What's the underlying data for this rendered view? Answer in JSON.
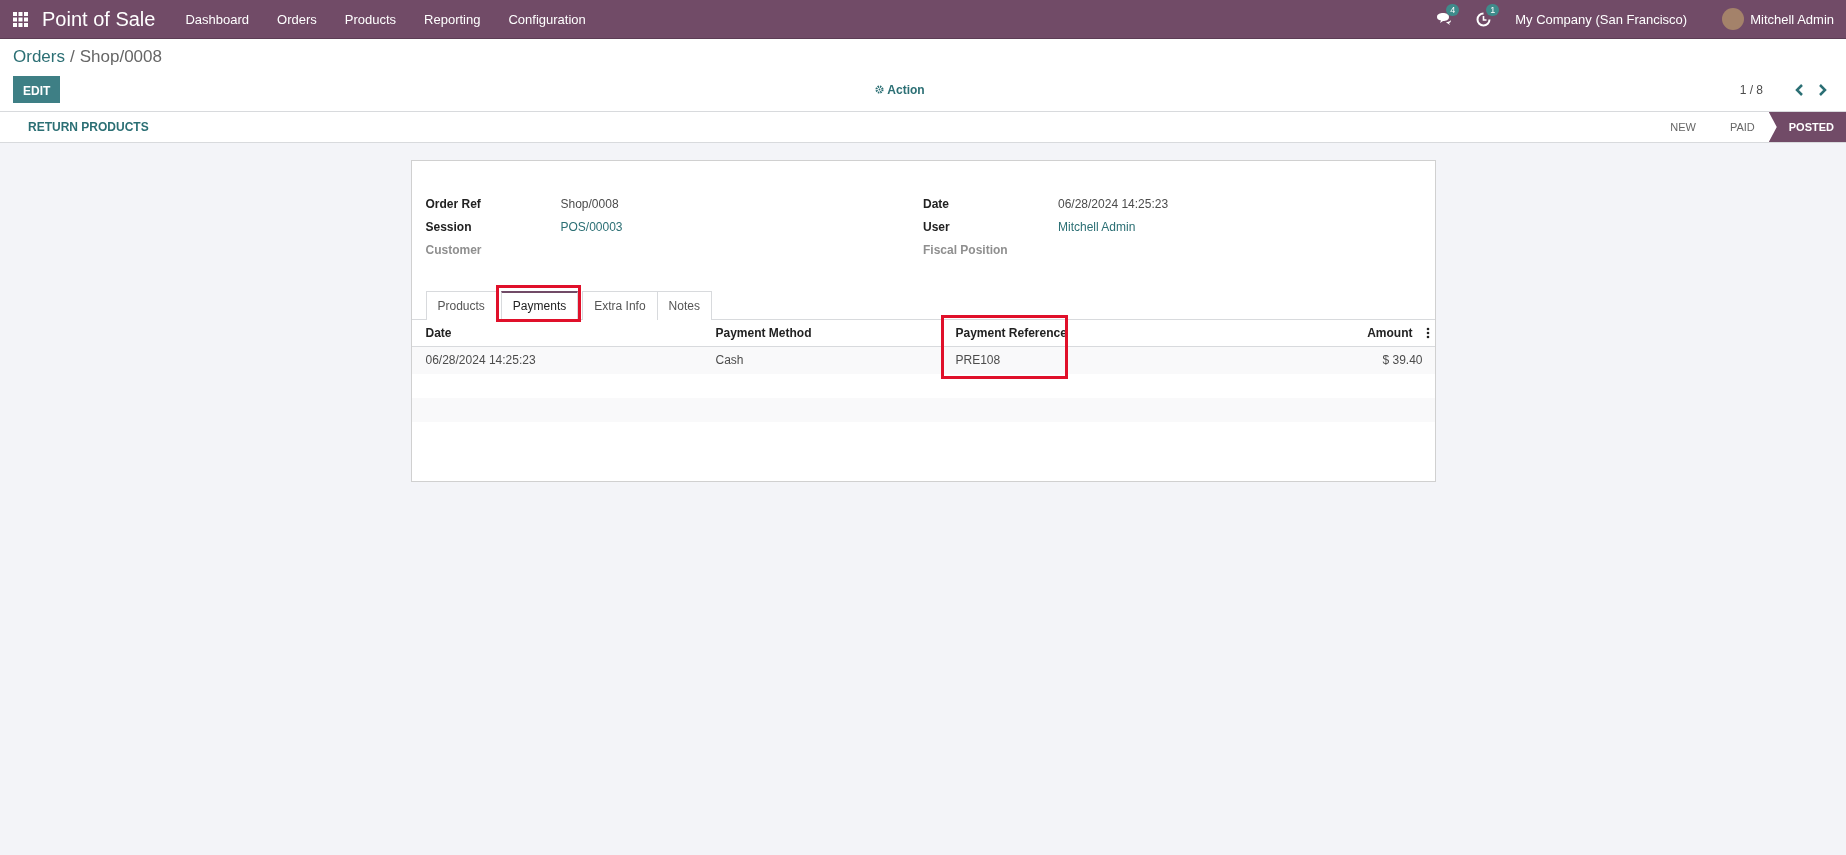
{
  "navbar": {
    "app_name": "Point of Sale",
    "menu": [
      "Dashboard",
      "Orders",
      "Products",
      "Reporting",
      "Configuration"
    ],
    "messages_count": "4",
    "activities_count": "1",
    "company": "My Company (San Francisco)",
    "user": "Mitchell Admin"
  },
  "breadcrumb": {
    "parent": "Orders",
    "separator": "/",
    "current": "Shop/0008"
  },
  "control_panel": {
    "edit_button": "EDIT",
    "action_button": "Action",
    "pager": "1 / 8"
  },
  "statusbar": {
    "buttons": [
      "RETURN PRODUCTS"
    ],
    "stages": [
      {
        "label": "NEW",
        "selected": false
      },
      {
        "label": "PAID",
        "selected": false
      },
      {
        "label": "POSTED",
        "selected": true
      }
    ]
  },
  "form": {
    "left_fields": [
      {
        "label": "Order Ref",
        "value": "Shop/0008",
        "kind": "text"
      },
      {
        "label": "Session",
        "value": "POS/00003",
        "kind": "link"
      },
      {
        "label": "Customer",
        "kind": "empty"
      }
    ],
    "right_fields": [
      {
        "label": "Date",
        "value": "06/28/2024 14:25:23",
        "kind": "text"
      },
      {
        "label": "User",
        "value": "Mitchell Admin",
        "kind": "link"
      },
      {
        "label": "Fiscal Position",
        "kind": "empty"
      }
    ],
    "tabs": [
      {
        "label": "Products",
        "selected": false,
        "highlighted": false
      },
      {
        "label": "Payments",
        "selected": true,
        "highlighted": true
      },
      {
        "label": "Extra Info",
        "selected": false,
        "highlighted": false
      },
      {
        "label": "Notes",
        "selected": false,
        "highlighted": false
      }
    ],
    "table": {
      "columns": [
        {
          "label": "Date",
          "kind": "text",
          "highlighted": false
        },
        {
          "label": "Payment Method",
          "kind": "text",
          "highlighted": false
        },
        {
          "label": "Payment Reference",
          "kind": "text",
          "highlighted": true
        },
        {
          "label": "Amount",
          "kind": "monetary",
          "highlighted": false
        }
      ],
      "rows": [
        [
          "06/28/2024 14:25:23",
          "Cash",
          "PRE108",
          "$ 39.40"
        ]
      ]
    }
  }
}
